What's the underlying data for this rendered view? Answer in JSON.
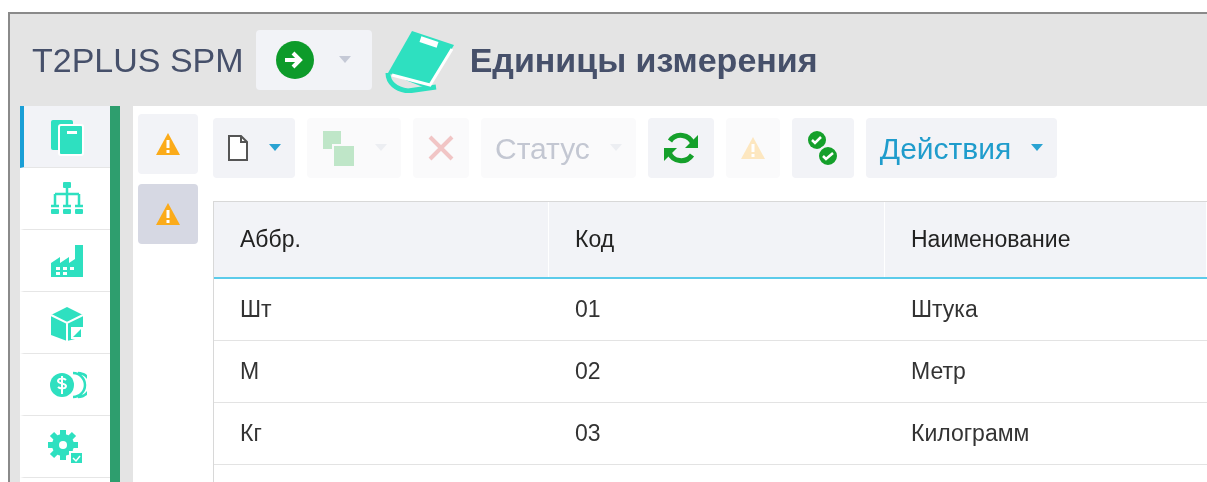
{
  "app": {
    "name": "T2PLUS SPM",
    "title": "Единицы измерения"
  },
  "sidebar": {
    "items": [
      {
        "selected": true
      },
      {
        "selected": false
      },
      {
        "selected": false
      },
      {
        "selected": false
      },
      {
        "selected": false
      },
      {
        "selected": false
      }
    ]
  },
  "side_tabs": [
    {
      "selected": false
    },
    {
      "selected": true
    }
  ],
  "toolbar": [
    {
      "kind": "new",
      "dropdown": true,
      "disabled": false
    },
    {
      "kind": "copy",
      "dropdown": true,
      "disabled": true
    },
    {
      "kind": "delete",
      "dropdown": false,
      "disabled": true
    },
    {
      "kind": "text",
      "label": "Статус",
      "dropdown": true,
      "disabled": true
    },
    {
      "kind": "refresh",
      "dropdown": false,
      "disabled": false
    },
    {
      "kind": "warning",
      "dropdown": false,
      "disabled": true
    },
    {
      "kind": "approve",
      "dropdown": false,
      "disabled": false
    },
    {
      "kind": "text",
      "label": "Действия",
      "dropdown": true,
      "disabled": false
    }
  ],
  "table": {
    "columns": [
      "Аббр.",
      "Код",
      "Наименование"
    ],
    "rows": [
      [
        "Шт",
        "01",
        "Штука"
      ],
      [
        "М",
        "02",
        "Метр"
      ],
      [
        "Кг",
        "03",
        "Килограмм"
      ]
    ]
  }
}
